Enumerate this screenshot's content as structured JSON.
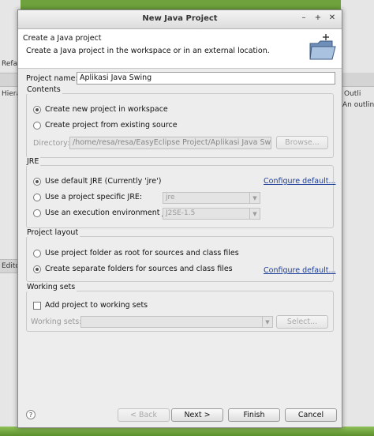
{
  "background": {
    "left_labels": [
      "Refa",
      "Hiera",
      "Edito"
    ],
    "right_labels": [
      "Outli",
      "An outline"
    ]
  },
  "window": {
    "title": "New Java Project",
    "controls": [
      "–",
      "+",
      "✕"
    ]
  },
  "header": {
    "title": "Create a Java project",
    "description": "Create a Java project in the workspace or in an external location.",
    "icon": "folder-java-icon"
  },
  "project_name": {
    "label": "Project name:",
    "value": "Aplikasi Java Swing"
  },
  "contents": {
    "title": "Contents",
    "option_new": "Create new project in workspace",
    "option_existing": "Create project from existing source",
    "directory_label": "Directory:",
    "directory_value": "/home/resa/resa/EasyEclipse Project/Aplikasi Java Swing",
    "browse_label": "Browse..."
  },
  "jre": {
    "title": "JRE",
    "option_default": "Use default JRE (Currently 'jre')",
    "option_specific": "Use a project specific JRE:",
    "option_env": "Use an execution environment JRE:",
    "specific_value": "jre",
    "env_value": "J2SE-1.5",
    "configure_link": "Configure default..."
  },
  "layout": {
    "title": "Project layout",
    "option_root": "Use project folder as root for sources and class files",
    "option_separate": "Create separate folders for sources and class files",
    "configure_link": "Configure default..."
  },
  "working_sets": {
    "title": "Working sets",
    "add_label": "Add project to working sets",
    "sets_label": "Working sets:",
    "select_label": "Select..."
  },
  "buttons": {
    "help": "?",
    "back": "< Back",
    "next": "Next >",
    "finish": "Finish",
    "cancel": "Cancel"
  },
  "colors": {
    "link": "#1a3d99",
    "desktop": "#6fa23c"
  }
}
